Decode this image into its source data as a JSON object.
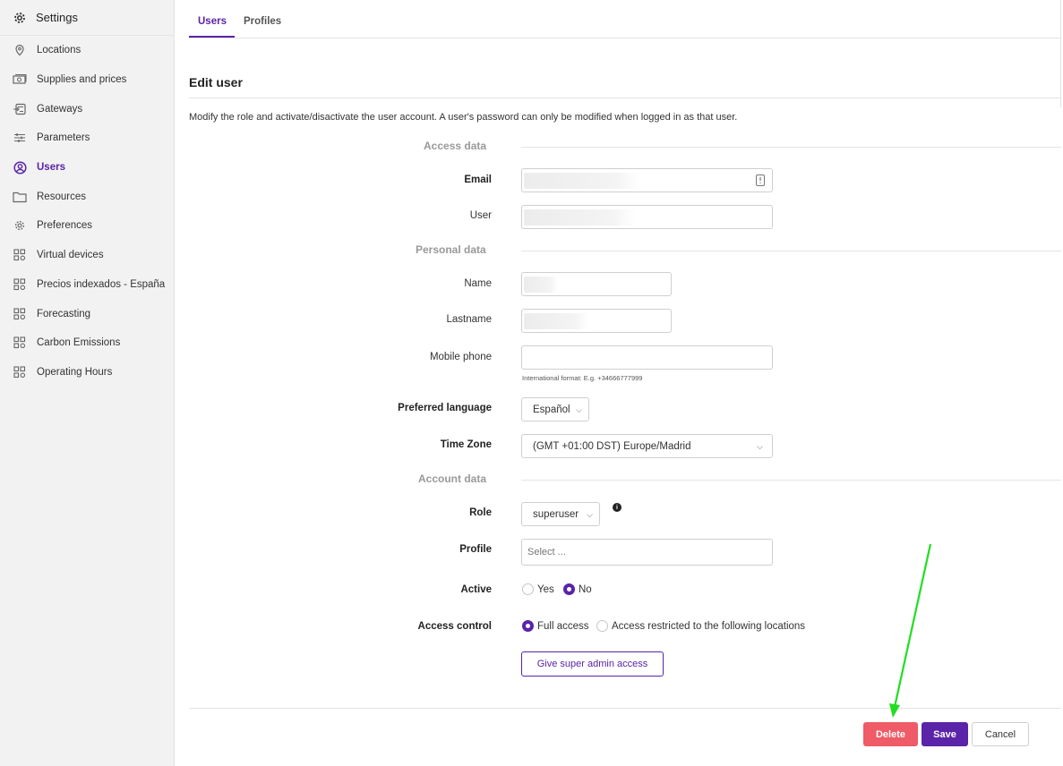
{
  "sidebar": {
    "header": {
      "title": "Settings",
      "icon": "gear-icon"
    },
    "items": [
      {
        "label": "Locations",
        "icon": "location-pin-icon",
        "active": false
      },
      {
        "label": "Supplies and prices",
        "icon": "money-icon",
        "active": false
      },
      {
        "label": "Gateways",
        "icon": "gateway-icon",
        "active": false
      },
      {
        "label": "Parameters",
        "icon": "sliders-icon",
        "active": false
      },
      {
        "label": "Users",
        "icon": "user-circle-icon",
        "active": true
      },
      {
        "label": "Resources",
        "icon": "folder-icon",
        "active": false
      },
      {
        "label": "Preferences",
        "icon": "gear-icon",
        "active": false
      },
      {
        "label": "Virtual devices",
        "icon": "app-grid-icon",
        "active": false
      },
      {
        "label": "Precios indexados - España",
        "icon": "app-grid-icon",
        "active": false
      },
      {
        "label": "Forecasting",
        "icon": "app-grid-icon",
        "active": false
      },
      {
        "label": "Carbon Emissions",
        "icon": "app-grid-icon",
        "active": false
      },
      {
        "label": "Operating Hours",
        "icon": "app-grid-icon",
        "active": false
      }
    ]
  },
  "tabs": [
    {
      "label": "Users",
      "active": true
    },
    {
      "label": "Profiles",
      "active": false
    }
  ],
  "page": {
    "title": "Edit user",
    "description": "Modify the role and activate/disactivate the user account. A user's password can only be modified when logged in as that user."
  },
  "sections": {
    "access": "Access data",
    "personal": "Personal data",
    "account": "Account data"
  },
  "fields": {
    "email": {
      "label": "Email",
      "value": ""
    },
    "user": {
      "label": "User",
      "value": ""
    },
    "name": {
      "label": "Name",
      "value": ""
    },
    "lastname": {
      "label": "Lastname",
      "value": ""
    },
    "mobile": {
      "label": "Mobile phone",
      "value": "",
      "hint": "International format: E.g. +34666777999"
    },
    "language": {
      "label": "Preferred language",
      "value": "Español"
    },
    "timezone": {
      "label": "Time Zone",
      "value": "(GMT +01:00 DST) Europe/Madrid"
    },
    "role": {
      "label": "Role",
      "value": "superuser"
    },
    "profile": {
      "label": "Profile",
      "placeholder": "Select ..."
    },
    "active": {
      "label": "Active",
      "options": [
        "Yes",
        "No"
      ],
      "selected": "No"
    },
    "access_control": {
      "label": "Access control",
      "options": [
        "Full access",
        "Access restricted to the following locations"
      ],
      "selected": "Full access"
    }
  },
  "buttons": {
    "super_admin": "Give super admin access",
    "delete": "Delete",
    "save": "Save",
    "cancel": "Cancel"
  },
  "colors": {
    "accent": "#5a23a8",
    "danger": "#ef5b66",
    "annotation_arrow": "#22dd22"
  }
}
